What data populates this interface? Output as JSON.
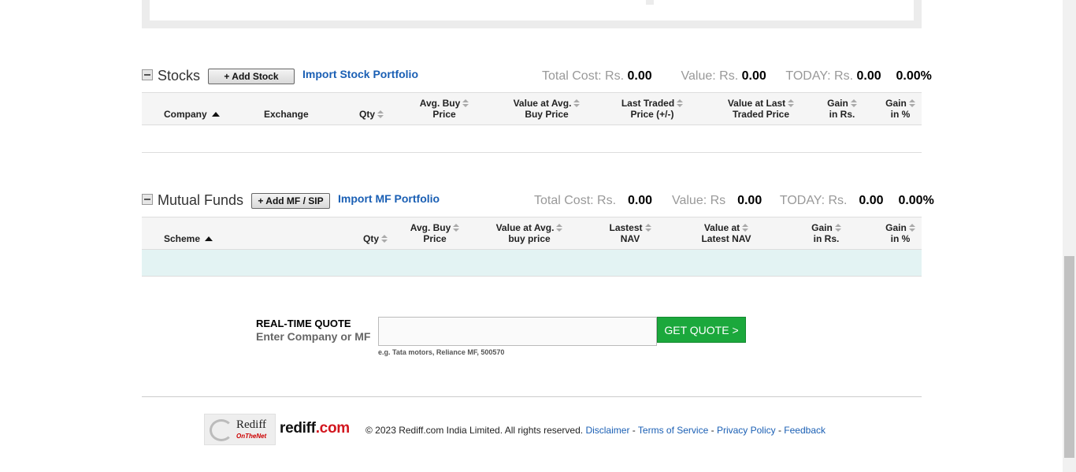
{
  "stocks": {
    "title": "Stocks",
    "add_button": "+ Add Stock",
    "import_link": "Import Stock Portfolio",
    "summary": {
      "total_cost_label": "Total Cost: Rs.",
      "total_cost_value": "0.00",
      "value_label": "Value: Rs.",
      "value_value": "0.00",
      "today_label": "TODAY: Rs.",
      "today_value": "0.00",
      "today_pct": "0.00%"
    },
    "columns": {
      "company": "Company",
      "exchange": "Exchange",
      "qty": "Qty",
      "avg_buy_1": "Avg. Buy",
      "avg_buy_2": "Price",
      "value_avg_1": "Value at Avg.",
      "value_avg_2": "Buy Price",
      "ltp_1": "Last Traded",
      "ltp_2": "Price (+/-)",
      "value_last_1": "Value at Last",
      "value_last_2": "Traded Price",
      "gain_rs_1": "Gain",
      "gain_rs_2": "in Rs.",
      "gain_pct_1": "Gain",
      "gain_pct_2": "in %"
    }
  },
  "mutual_funds": {
    "title": "Mutual Funds",
    "add_button": "+ Add MF / SIP",
    "import_link": "Import MF Portfolio",
    "summary": {
      "total_cost_label": "Total Cost: Rs.",
      "total_cost_value": "0.00",
      "value_label": "Value: Rs",
      "value_value": "0.00",
      "today_label": "TODAY: Rs.",
      "today_value": "0.00",
      "today_pct": "0.00%"
    },
    "columns": {
      "scheme": "Scheme",
      "qty": "Qty",
      "avg_buy_1": "Avg. Buy",
      "avg_buy_2": "Price",
      "value_avg_1": "Value at Avg.",
      "value_avg_2": "buy price",
      "nav_1": "Lastest",
      "nav_2": "NAV",
      "value_nav_1": "Value at",
      "value_nav_2": "Latest NAV",
      "gain_rs_1": "Gain",
      "gain_rs_2": "in Rs.",
      "gain_pct_1": "Gain",
      "gain_pct_2": "in %"
    }
  },
  "quote": {
    "title": "REAL-TIME QUOTE",
    "subtitle": "Enter Company or MF",
    "input_value": "",
    "button": "GET QUOTE >",
    "example": "e.g. Tata motors, Reliance MF, 500570"
  },
  "footer": {
    "logo_line1": "Rediff",
    "logo_line2": "OnTheNet",
    "brand_main": "rediff",
    "brand_com": ".com",
    "copyright": "© 2023 Rediff.com India Limited. All rights reserved.",
    "links": [
      "Disclaimer",
      "Terms of Service",
      "Privacy Policy",
      "Feedback"
    ],
    "separator": " - "
  },
  "colors": {
    "link": "#1a5fb4",
    "quote_button": "#1ba83c",
    "mf_row": "#e3f3f3",
    "brand_red": "#d2161e"
  }
}
